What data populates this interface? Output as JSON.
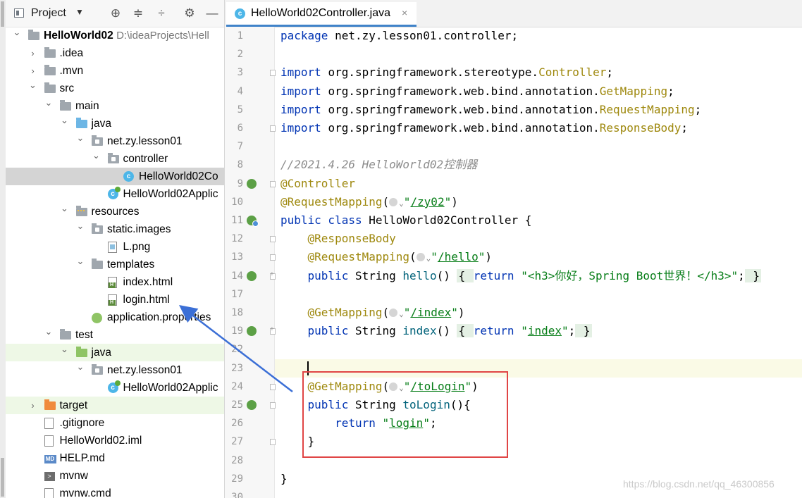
{
  "project_panel": {
    "title": "Project",
    "dropdown": "▼",
    "header_icons": [
      "target-icon",
      "expand-all-icon",
      "collapse-all-icon",
      "settings-icon",
      "minimize-icon"
    ],
    "tree": [
      {
        "label": "HelloWorld02",
        "path": "D:\\ideaProjects\\Hell",
        "icon": "module-folder"
      },
      {
        "label": ".idea",
        "icon": "folder"
      },
      {
        "label": ".mvn",
        "icon": "folder"
      },
      {
        "label": "src",
        "icon": "folder"
      },
      {
        "label": "main",
        "icon": "folder"
      },
      {
        "label": "java",
        "icon": "source-folder"
      },
      {
        "label": "net.zy.lesson01",
        "icon": "package"
      },
      {
        "label": "controller",
        "icon": "package"
      },
      {
        "label": "HelloWorld02Co",
        "icon": "java-class"
      },
      {
        "label": "HelloWorld02Applic",
        "icon": "spring-app-class"
      },
      {
        "label": "resources",
        "icon": "resources-folder"
      },
      {
        "label": "static.images",
        "icon": "package"
      },
      {
        "label": "L.png",
        "icon": "png-file"
      },
      {
        "label": "templates",
        "icon": "folder"
      },
      {
        "label": "index.html",
        "icon": "html-file"
      },
      {
        "label": "login.html",
        "icon": "html-file"
      },
      {
        "label": "application.properties",
        "icon": "properties-file"
      },
      {
        "label": "test",
        "icon": "folder"
      },
      {
        "label": "java",
        "icon": "test-source-folder"
      },
      {
        "label": "net.zy.lesson01",
        "icon": "package"
      },
      {
        "label": "HelloWorld02Applic",
        "icon": "spring-app-class"
      },
      {
        "label": "target",
        "icon": "excluded-folder"
      },
      {
        "label": ".gitignore",
        "icon": "gitignore-file"
      },
      {
        "label": "HelloWorld02.iml",
        "icon": "iml-file"
      },
      {
        "label": "HELP.md",
        "icon": "markdown-file"
      },
      {
        "label": "mvnw",
        "icon": "shell-file"
      },
      {
        "label": "mvnw.cmd",
        "icon": "cmd-file"
      }
    ]
  },
  "editor": {
    "tab_label": "HelloWorld02Controller.java",
    "tab_close": "×",
    "lines": [
      {
        "n": "1",
        "segs": [
          [
            "kw",
            "package "
          ],
          [
            "",
            "net.zy.lesson01.controller;"
          ]
        ]
      },
      {
        "n": "2",
        "segs": []
      },
      {
        "n": "3",
        "segs": [
          [
            "kw",
            "import "
          ],
          [
            "",
            "org.springframework.stereotype."
          ],
          [
            "ann",
            "Controller"
          ],
          [
            "",
            ";"
          ]
        ]
      },
      {
        "n": "4",
        "segs": [
          [
            "kw",
            "import "
          ],
          [
            "",
            "org.springframework.web.bind.annotation."
          ],
          [
            "ann",
            "GetMapping"
          ],
          [
            "",
            ";"
          ]
        ]
      },
      {
        "n": "5",
        "segs": [
          [
            "kw",
            "import "
          ],
          [
            "",
            "org.springframework.web.bind.annotation."
          ],
          [
            "ann",
            "RequestMapping"
          ],
          [
            "",
            ";"
          ]
        ]
      },
      {
        "n": "6",
        "segs": [
          [
            "kw",
            "import "
          ],
          [
            "",
            "org.springframework.web.bind.annotation."
          ],
          [
            "ann",
            "ResponseBody"
          ],
          [
            "",
            ";"
          ]
        ]
      },
      {
        "n": "7",
        "segs": []
      },
      {
        "n": "8",
        "segs": [
          [
            "cmt",
            "//2021.4.26 HelloWorld02控制器"
          ]
        ]
      },
      {
        "n": "9",
        "segs": [
          [
            "ann",
            "@Controller"
          ]
        ]
      },
      {
        "n": "10",
        "segs": [
          [
            "ann",
            "@RequestMapping"
          ],
          [
            "",
            "("
          ],
          [
            "globe",
            ""
          ],
          [
            "caret",
            "⌄"
          ],
          [
            "str",
            "\""
          ],
          [
            "link",
            "/zy02"
          ],
          [
            "str",
            "\""
          ],
          [
            "",
            ")"
          ]
        ]
      },
      {
        "n": "11",
        "segs": [
          [
            "kw",
            "public class "
          ],
          [
            "",
            "HelloWorld02Controller {"
          ]
        ]
      },
      {
        "n": "12",
        "segs": [
          [
            "",
            "    "
          ],
          [
            "ann",
            "@ResponseBody"
          ]
        ]
      },
      {
        "n": "13",
        "segs": [
          [
            "",
            "    "
          ],
          [
            "ann",
            "@RequestMapping"
          ],
          [
            "",
            "("
          ],
          [
            "globe",
            ""
          ],
          [
            "caret",
            "⌄"
          ],
          [
            "str",
            "\""
          ],
          [
            "link",
            "/hello"
          ],
          [
            "str",
            "\""
          ],
          [
            "",
            ")"
          ]
        ]
      },
      {
        "n": "14",
        "segs": [
          [
            "",
            "    "
          ],
          [
            "kw",
            "public "
          ],
          [
            "",
            "String "
          ],
          [
            "fn",
            "hello"
          ],
          [
            "",
            "() "
          ],
          [
            "fold",
            "{ "
          ],
          [
            "kw",
            "return "
          ],
          [
            "str",
            "\"<h3>你好，Spring Boot世界！</h3>\""
          ],
          [
            "",
            ";"
          ],
          [
            "fold",
            " }"
          ]
        ]
      },
      {
        "n": "17",
        "segs": []
      },
      {
        "n": "18",
        "segs": [
          [
            "",
            "    "
          ],
          [
            "ann",
            "@GetMapping"
          ],
          [
            "",
            "("
          ],
          [
            "globe",
            ""
          ],
          [
            "caret",
            "⌄"
          ],
          [
            "str",
            "\""
          ],
          [
            "link",
            "/index"
          ],
          [
            "str",
            "\""
          ],
          [
            "",
            ")"
          ]
        ]
      },
      {
        "n": "19",
        "segs": [
          [
            "",
            "    "
          ],
          [
            "kw",
            "public "
          ],
          [
            "",
            "String "
          ],
          [
            "fn",
            "index"
          ],
          [
            "",
            "() "
          ],
          [
            "fold",
            "{ "
          ],
          [
            "kw",
            "return "
          ],
          [
            "str",
            "\""
          ],
          [
            "link",
            "index"
          ],
          [
            "str",
            "\""
          ],
          [
            "",
            ";"
          ],
          [
            "fold",
            " }"
          ]
        ]
      },
      {
        "n": "22",
        "segs": []
      },
      {
        "n": "23",
        "segs": []
      },
      {
        "n": "24",
        "segs": [
          [
            "",
            "    "
          ],
          [
            "ann",
            "@GetMapping"
          ],
          [
            "",
            "("
          ],
          [
            "globe",
            ""
          ],
          [
            "caret",
            "⌄"
          ],
          [
            "str",
            "\""
          ],
          [
            "link",
            "/toLogin"
          ],
          [
            "str",
            "\""
          ],
          [
            "",
            ")"
          ]
        ]
      },
      {
        "n": "25",
        "segs": [
          [
            "",
            "    "
          ],
          [
            "kw",
            "public "
          ],
          [
            "",
            "String "
          ],
          [
            "fn",
            "toLogin"
          ],
          [
            "",
            "(){"
          ]
        ]
      },
      {
        "n": "26",
        "segs": [
          [
            "",
            "        "
          ],
          [
            "kw",
            "return "
          ],
          [
            "str",
            "\""
          ],
          [
            "link",
            "login"
          ],
          [
            "str",
            "\""
          ],
          [
            "",
            ";"
          ]
        ]
      },
      {
        "n": "27",
        "segs": [
          [
            "",
            "    }"
          ]
        ]
      },
      {
        "n": "28",
        "segs": []
      },
      {
        "n": "29",
        "segs": [
          [
            "",
            "}"
          ]
        ]
      },
      {
        "n": "30",
        "segs": []
      }
    ]
  },
  "watermark": "https://blog.csdn.net/qq_46300856",
  "colors": {
    "keyword": "#0033b3",
    "annotation": "#9e880d",
    "string": "#067d17",
    "comment": "#8c8c8c",
    "highlight_box": "#e04545",
    "arrow": "#3b6fd6"
  }
}
